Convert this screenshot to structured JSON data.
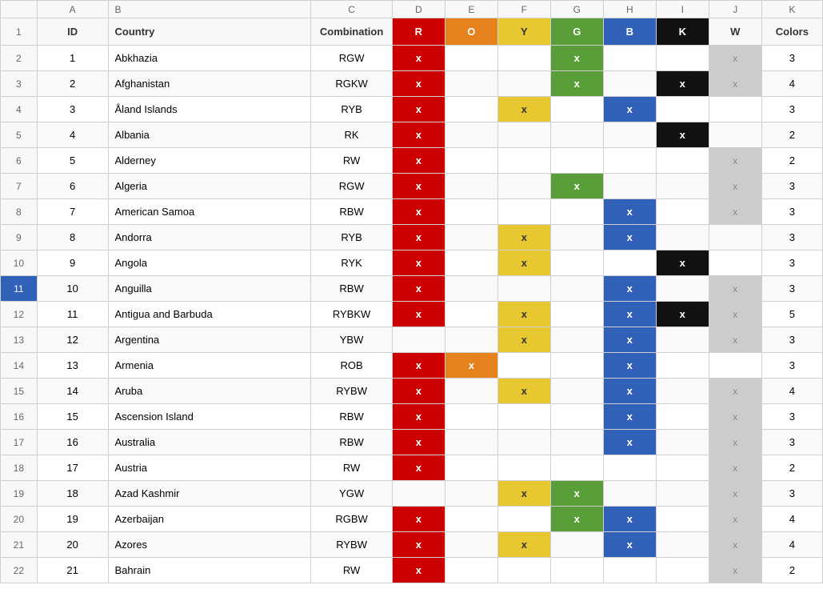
{
  "columns": {
    "row_num": "",
    "a": "ID",
    "b": "Country",
    "c": "Combination",
    "d": "R",
    "e": "O",
    "f": "Y",
    "g": "G",
    "h": "B",
    "i": "K",
    "j": "W",
    "k": "Colors"
  },
  "col_letters": [
    "",
    "A",
    "B",
    "C",
    "D",
    "E",
    "F",
    "G",
    "H",
    "I",
    "J",
    "K"
  ],
  "rows": [
    {
      "row": 2,
      "id": 1,
      "country": "Abkhazia",
      "combo": "RGW",
      "R": true,
      "O": false,
      "Y": false,
      "G": true,
      "B": false,
      "K": false,
      "W": true,
      "colors": 3
    },
    {
      "row": 3,
      "id": 2,
      "country": "Afghanistan",
      "combo": "RGKW",
      "R": true,
      "O": false,
      "Y": false,
      "G": true,
      "B": false,
      "K": true,
      "W": true,
      "colors": 4
    },
    {
      "row": 4,
      "id": 3,
      "country": "Åland Islands",
      "combo": "RYB",
      "R": true,
      "O": false,
      "Y": true,
      "G": false,
      "B": true,
      "K": false,
      "W": false,
      "colors": 3
    },
    {
      "row": 5,
      "id": 4,
      "country": "Albania",
      "combo": "RK",
      "R": true,
      "O": false,
      "Y": false,
      "G": false,
      "B": false,
      "K": true,
      "W": false,
      "colors": 2
    },
    {
      "row": 6,
      "id": 5,
      "country": "Alderney",
      "combo": "RW",
      "R": true,
      "O": false,
      "Y": false,
      "G": false,
      "B": false,
      "K": false,
      "W": true,
      "colors": 2
    },
    {
      "row": 7,
      "id": 6,
      "country": "Algeria",
      "combo": "RGW",
      "R": true,
      "O": false,
      "Y": false,
      "G": true,
      "B": false,
      "K": false,
      "W": true,
      "colors": 3
    },
    {
      "row": 8,
      "id": 7,
      "country": "American Samoa",
      "combo": "RBW",
      "R": true,
      "O": false,
      "Y": false,
      "G": false,
      "B": true,
      "K": false,
      "W": true,
      "colors": 3
    },
    {
      "row": 9,
      "id": 8,
      "country": "Andorra",
      "combo": "RYB",
      "R": true,
      "O": false,
      "Y": true,
      "G": false,
      "B": true,
      "K": false,
      "W": false,
      "colors": 3
    },
    {
      "row": 10,
      "id": 9,
      "country": "Angola",
      "combo": "RYK",
      "R": true,
      "O": false,
      "Y": true,
      "G": false,
      "B": false,
      "K": true,
      "W": false,
      "colors": 3
    },
    {
      "row": 11,
      "id": 10,
      "country": "Anguilla",
      "combo": "RBW",
      "R": true,
      "O": false,
      "Y": false,
      "G": false,
      "B": true,
      "K": false,
      "W": true,
      "colors": 3,
      "selected": true
    },
    {
      "row": 12,
      "id": 11,
      "country": "Antigua and Barbuda",
      "combo": "RYBKW",
      "R": true,
      "O": false,
      "Y": true,
      "G": false,
      "B": true,
      "K": true,
      "W": true,
      "colors": 5
    },
    {
      "row": 13,
      "id": 12,
      "country": "Argentina",
      "combo": "YBW",
      "R": false,
      "O": false,
      "Y": true,
      "G": false,
      "B": true,
      "K": false,
      "W": true,
      "colors": 3
    },
    {
      "row": 14,
      "id": 13,
      "country": "Armenia",
      "combo": "ROB",
      "R": true,
      "O": true,
      "Y": false,
      "G": false,
      "B": true,
      "K": false,
      "W": false,
      "colors": 3
    },
    {
      "row": 15,
      "id": 14,
      "country": "Aruba",
      "combo": "RYBW",
      "R": true,
      "O": false,
      "Y": true,
      "G": false,
      "B": true,
      "K": false,
      "W": true,
      "colors": 4
    },
    {
      "row": 16,
      "id": 15,
      "country": "Ascension Island",
      "combo": "RBW",
      "R": true,
      "O": false,
      "Y": false,
      "G": false,
      "B": true,
      "K": false,
      "W": true,
      "colors": 3
    },
    {
      "row": 17,
      "id": 16,
      "country": "Australia",
      "combo": "RBW",
      "R": true,
      "O": false,
      "Y": false,
      "G": false,
      "B": true,
      "K": false,
      "W": true,
      "colors": 3
    },
    {
      "row": 18,
      "id": 17,
      "country": "Austria",
      "combo": "RW",
      "R": true,
      "O": false,
      "Y": false,
      "G": false,
      "B": false,
      "K": false,
      "W": false,
      "colors": 2
    },
    {
      "row": 19,
      "id": 18,
      "country": "Azad Kashmir",
      "combo": "YGW",
      "R": false,
      "O": false,
      "Y": true,
      "G": true,
      "B": false,
      "K": false,
      "W": true,
      "colors": 3
    },
    {
      "row": 20,
      "id": 19,
      "country": "Azerbaijan",
      "combo": "RGBW",
      "R": true,
      "O": false,
      "Y": false,
      "G": true,
      "B": true,
      "K": false,
      "W": true,
      "colors": 4
    },
    {
      "row": 21,
      "id": 20,
      "country": "Azores",
      "combo": "RYBW",
      "R": true,
      "O": false,
      "Y": true,
      "G": false,
      "B": true,
      "K": false,
      "W": true,
      "colors": 4
    },
    {
      "row": 22,
      "id": 21,
      "country": "Bahrain",
      "combo": "RW",
      "R": true,
      "O": false,
      "Y": false,
      "G": false,
      "B": false,
      "K": false,
      "W": false,
      "colors": 2
    }
  ]
}
